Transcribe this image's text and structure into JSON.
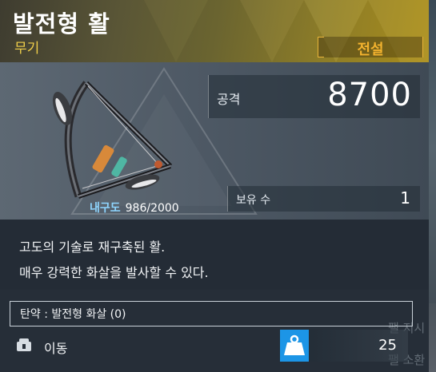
{
  "item": {
    "name": "발전형 활",
    "category": "무기",
    "rarity": "전설"
  },
  "stats": {
    "attack_label": "공격",
    "attack_value": "8700",
    "durability_label": "내구도",
    "durability_value": "986/2000",
    "owned_label": "보유 수",
    "owned_value": "1"
  },
  "description": [
    "고도의 기술로 재구축된 활.",
    "매우 강력한 화살을 발사할 수 있다."
  ],
  "ammo_text": "탄약 : 발전형 화살 (0)",
  "move_label": "이동",
  "weight_value": "25",
  "background_text": [
    "팰 지시",
    "팰 소환"
  ],
  "colors": {
    "rarity": "#f2b22e",
    "category": "#f0cf4a",
    "durability_label": "#8fd6ff",
    "weight_icon_bg": "#1c95e6"
  },
  "icons": [
    "bow-weapon-image",
    "move-icon",
    "weight-icon"
  ]
}
